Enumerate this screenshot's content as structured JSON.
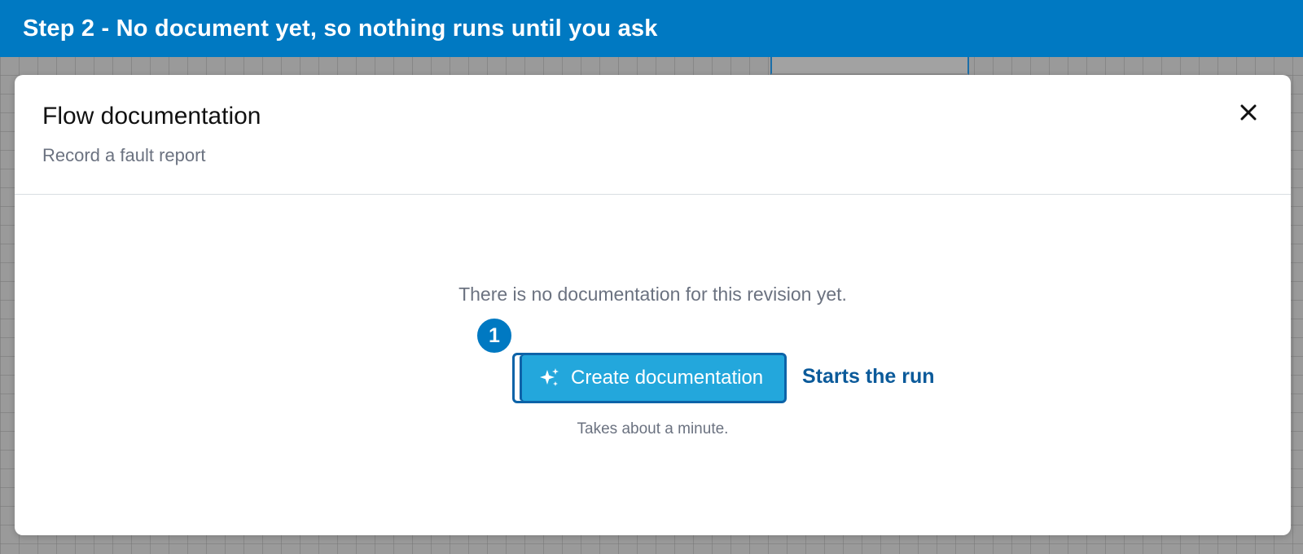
{
  "banner": {
    "text": "Step 2 - No document yet, so nothing runs until you ask"
  },
  "dialog": {
    "title": "Flow documentation",
    "subtitle": "Record a fault report",
    "close_icon": "close-icon",
    "empty_message": "There is no documentation for this revision yet.",
    "create_button_label": "Create documentation",
    "create_button_icon": "sparkle-icon",
    "hint": "Takes about a minute."
  },
  "annotation": {
    "step_number": "1",
    "callout": "Starts the run"
  },
  "colors": {
    "banner": "#0079c2",
    "button": "#23a7dc",
    "button_border": "#0d63a8",
    "callout": "#0b5a9a",
    "muted_text": "#6b7280",
    "backdrop": "#9a9a9a"
  }
}
